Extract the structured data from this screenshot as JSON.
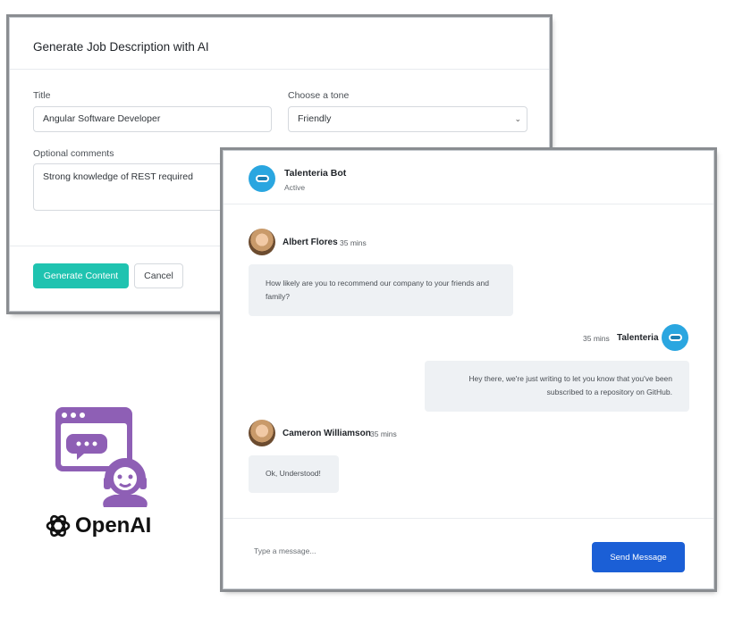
{
  "job_modal": {
    "title": "Generate Job Description with AI",
    "title_field": {
      "label": "Title",
      "value": "Angular Software Developer"
    },
    "tone_field": {
      "label": "Choose a tone",
      "selected": "Friendly"
    },
    "comments_field": {
      "label": "Optional comments",
      "value": "Strong knowledge of REST required"
    },
    "generate_button": "Generate Content",
    "cancel_button": "Cancel",
    "accent_color": "#1fc3b0"
  },
  "chat": {
    "bot": {
      "name": "Talenteria Bot",
      "status": "Active",
      "avatar_icon": "robot-icon"
    },
    "messages": [
      {
        "author": "Albert Flores",
        "time": "35 mins",
        "text": "How likely are you to recommend our company to your friends and family?",
        "side": "left"
      },
      {
        "author": "Talenteria",
        "time": "35 mins",
        "text": "Hey there, we're just writing to let you know that you've been subscribed to a repository on GitHub.",
        "side": "right"
      },
      {
        "author": "Cameron Williamson",
        "time": "35 mins",
        "text": "Ok, Understood!",
        "side": "left"
      }
    ],
    "input_placeholder": "Type a message...",
    "send_button": "Send Message",
    "send_color": "#1b5fd6"
  },
  "branding": {
    "support_icon": "chat-support-icon",
    "openai_icon": "openai-icon",
    "openai_label": "OpenAI",
    "support_color": "#8e5fb5"
  }
}
